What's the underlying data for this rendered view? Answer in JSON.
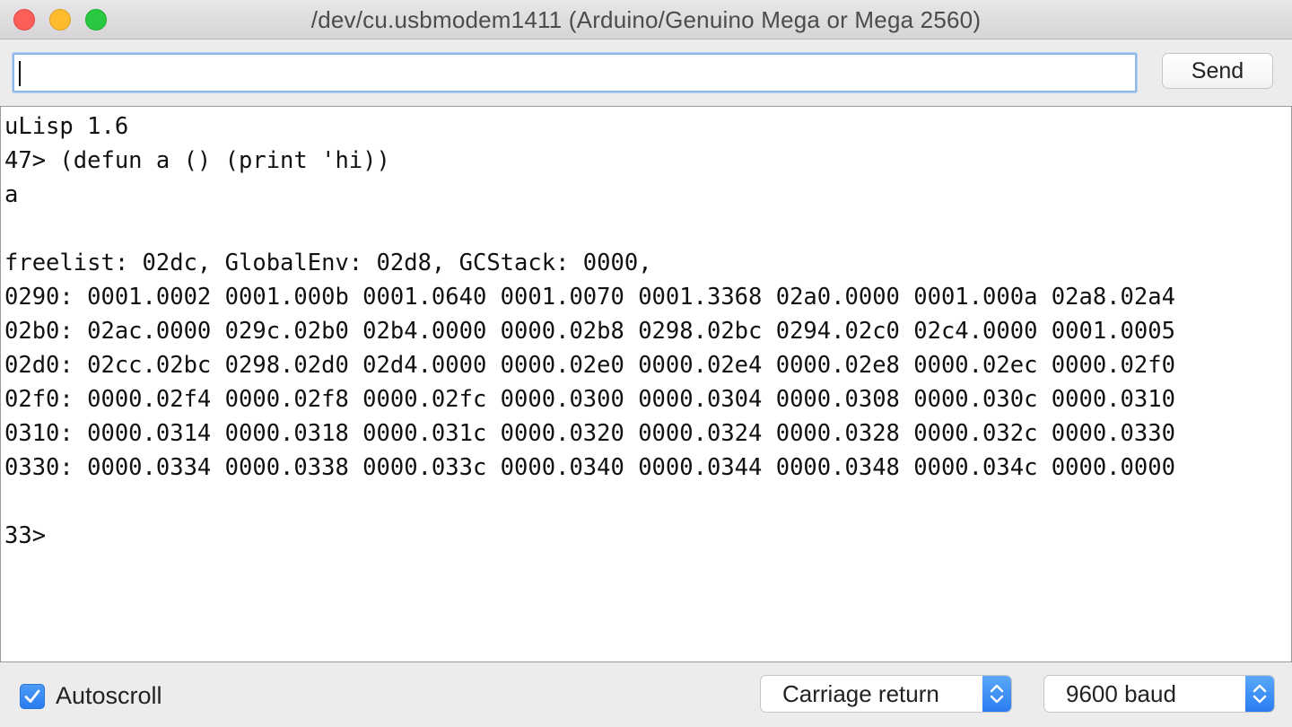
{
  "window": {
    "title": "/dev/cu.usbmodem1411 (Arduino/Genuino Mega or Mega 2560)"
  },
  "toolbar": {
    "input_value": "",
    "send_label": "Send"
  },
  "output": {
    "lines": [
      "uLisp 1.6",
      "47> (defun a () (print 'hi))",
      "a",
      "",
      "freelist: 02dc, GlobalEnv: 02d8, GCStack: 0000,",
      "0290: 0001.0002 0001.000b 0001.0640 0001.0070 0001.3368 02a0.0000 0001.000a 02a8.02a4",
      "02b0: 02ac.0000 029c.02b0 02b4.0000 0000.02b8 0298.02bc 0294.02c0 02c4.0000 0001.0005",
      "02d0: 02cc.02bc 0298.02d0 02d4.0000 0000.02e0 0000.02e4 0000.02e8 0000.02ec 0000.02f0",
      "02f0: 0000.02f4 0000.02f8 0000.02fc 0000.0300 0000.0304 0000.0308 0000.030c 0000.0310",
      "0310: 0000.0314 0000.0318 0000.031c 0000.0320 0000.0324 0000.0328 0000.032c 0000.0330",
      "0330: 0000.0334 0000.0338 0000.033c 0000.0340 0000.0344 0000.0348 0000.034c 0000.0000",
      "",
      "33>"
    ]
  },
  "bottom": {
    "autoscroll_label": "Autoscroll",
    "autoscroll_checked": true,
    "line_ending": "Carriage return",
    "baud_rate": "9600 baud"
  },
  "icons": {
    "checkmark": "checkmark-icon",
    "stepper": "up-down-chevron-icon"
  },
  "colors": {
    "close": "#fc5f57",
    "minimize": "#fdbc2e",
    "maximize": "#28c840",
    "accent": "#2a7cf0"
  }
}
